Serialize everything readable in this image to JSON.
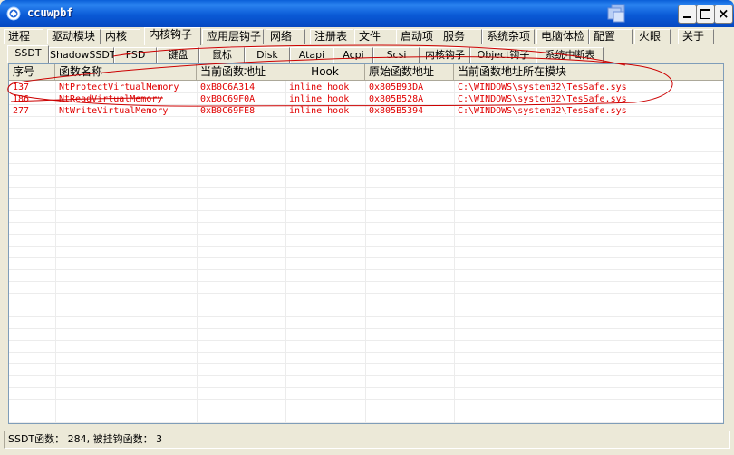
{
  "window": {
    "title": "ccuwpbf",
    "minimize_label": "",
    "maximize_label": "",
    "close_label": "×"
  },
  "main_tabs": [
    {
      "label": "进程"
    },
    {
      "label": "驱动模块"
    },
    {
      "label": "内核"
    },
    {
      "label": "内核钩子",
      "active": true
    },
    {
      "label": "应用层钩子"
    },
    {
      "label": "网络"
    },
    {
      "label": "注册表"
    },
    {
      "label": "文件"
    },
    {
      "label": "启动项"
    },
    {
      "label": "服务"
    },
    {
      "label": "系统杂项"
    },
    {
      "label": "电脑体检"
    },
    {
      "label": "配置"
    },
    {
      "label": "火眼"
    },
    {
      "label": "关于"
    }
  ],
  "sub_tabs": [
    {
      "label": "SSDT",
      "active": true
    },
    {
      "label": "ShadowSSDT"
    },
    {
      "label": "FSD"
    },
    {
      "label": "键盘"
    },
    {
      "label": "鼠标"
    },
    {
      "label": "Disk"
    },
    {
      "label": "Atapi"
    },
    {
      "label": "Acpi"
    },
    {
      "label": "Scsi"
    },
    {
      "label": "内核钩子"
    },
    {
      "label": "Object钩子"
    },
    {
      "label": "系统中断表"
    }
  ],
  "table": {
    "columns": [
      "序号",
      "函数名称",
      "当前函数地址",
      "Hook",
      "原始函数地址",
      "当前函数地址所在模块"
    ],
    "rows": [
      [
        "137",
        "NtProtectVirtualMemory",
        "0xB0C6A314",
        "inline hook",
        "0x805B93DA",
        "C:\\WINDOWS\\system32\\TesSafe.sys"
      ],
      [
        "186",
        "NtReadVirtualMemory",
        "0xB0C69F0A",
        "inline hook",
        "0x805B528A",
        "C:\\WINDOWS\\system32\\TesSafe.sys"
      ],
      [
        "277",
        "NtWriteVirtualMemory",
        "0xB0C69FE8",
        "inline hook",
        "0x805B5394",
        "C:\\WINDOWS\\system32\\TesSafe.sys"
      ]
    ]
  },
  "status": {
    "text": "SSDT函数： 284,  被挂钩函数： 3"
  },
  "colors": {
    "hooked_text": "#e00000",
    "title_bar": "#0a5fd8",
    "annotation": "#cc0000"
  },
  "icons": {
    "app": "app-logo-icon",
    "tray": "window-stack-icon"
  }
}
